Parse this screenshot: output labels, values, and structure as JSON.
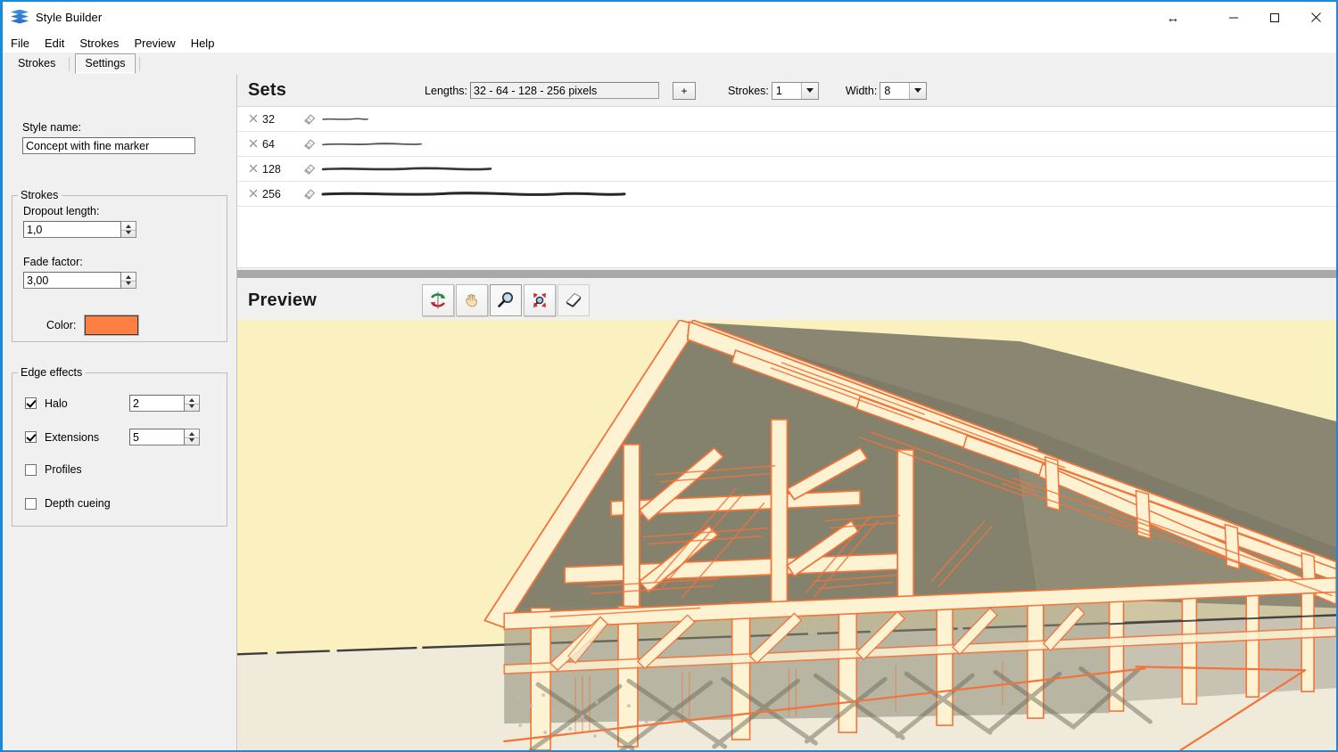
{
  "window": {
    "title": "Style Builder",
    "app_icon": "stack-layers-icon",
    "controls": {
      "resize": "↔",
      "minimize": "–",
      "maximize": "□",
      "close": "✕"
    }
  },
  "menubar": {
    "items": [
      {
        "label": "File"
      },
      {
        "label": "Edit"
      },
      {
        "label": "Strokes"
      },
      {
        "label": "Preview"
      },
      {
        "label": "Help"
      }
    ]
  },
  "tabs": {
    "items": [
      {
        "label": "Strokes",
        "selected": false
      },
      {
        "label": "Settings",
        "selected": true
      }
    ]
  },
  "settings": {
    "style_name": {
      "label": "Style name:",
      "value": "Concept with fine marker",
      "placeholder": ""
    },
    "strokes_group": {
      "legend": "Strokes",
      "dropout_length": {
        "label": "Dropout length:",
        "value": "1,0"
      },
      "fade_factor": {
        "label": "Fade factor:",
        "value": "3,00"
      },
      "color": {
        "label": "Color:",
        "value": "#ff7f43"
      }
    },
    "edge_effects_group": {
      "legend": "Edge effects",
      "items": [
        {
          "label": "Halo",
          "checked": true,
          "value": "2"
        },
        {
          "label": "Extensions",
          "checked": true,
          "value": "5"
        },
        {
          "label": "Profiles",
          "checked": false,
          "value": ""
        },
        {
          "label": "Depth cueing",
          "checked": false,
          "value": ""
        }
      ]
    }
  },
  "sets": {
    "title": "Sets",
    "lengths": {
      "label": "Lengths:",
      "value": "32 - 64 - 128 - 256 pixels"
    },
    "add_button": "+",
    "strokes_select": {
      "label": "Strokes:",
      "value": "1"
    },
    "width_select": {
      "label": "Width:",
      "value": "8"
    },
    "rows": [
      {
        "delete_icon": "close-x-icon",
        "length": "32",
        "edit_icon": "eraser-icon"
      },
      {
        "delete_icon": "close-x-icon",
        "length": "64",
        "edit_icon": "eraser-icon"
      },
      {
        "delete_icon": "close-x-icon",
        "length": "128",
        "edit_icon": "eraser-icon"
      },
      {
        "delete_icon": "close-x-icon",
        "length": "256",
        "edit_icon": "eraser-icon"
      }
    ]
  },
  "preview": {
    "title": "Preview",
    "tools": [
      {
        "name": "orbit-icon",
        "active": false
      },
      {
        "name": "pan-hand-icon",
        "active": false
      },
      {
        "name": "zoom-magnifier-icon",
        "active": true
      },
      {
        "name": "zoom-extents-icon",
        "active": false
      },
      {
        "name": "page-reset-icon",
        "active": false
      }
    ],
    "scene": {
      "description": "timber frame barn sketch",
      "sky_color": "#faf0c0",
      "ground_color": "#efead9",
      "shadow_color": "#7d7a68",
      "timber_fill": "#fdf3d2",
      "edge_color": "#f2743a"
    }
  }
}
